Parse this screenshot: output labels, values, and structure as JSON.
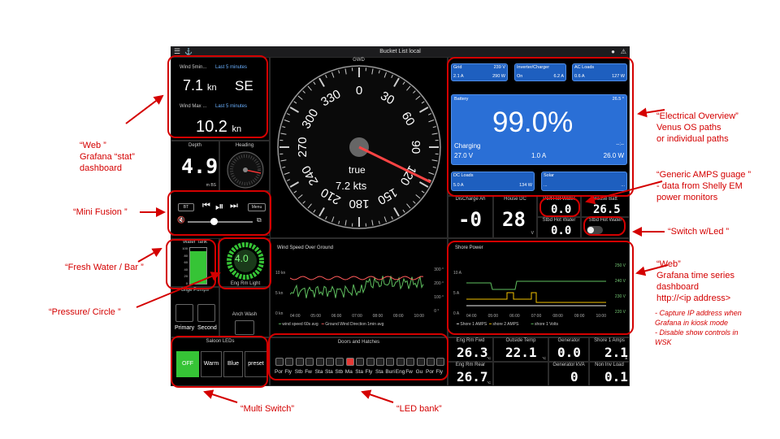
{
  "topbar": {
    "title": "Bucket List local"
  },
  "wind_speed": {
    "label": "Wind 5min...",
    "period": "Last 5 minutes",
    "value": "7.1",
    "unit": "kn",
    "direction": "SE"
  },
  "wind_max": {
    "label": "Wind Max ...",
    "period": "Last 5 minutes",
    "value": "10.2",
    "unit": "kn"
  },
  "depth": {
    "label": "Depth",
    "value": "4.9",
    "unit": "m BS"
  },
  "heading": {
    "label": "Heading"
  },
  "gwd": {
    "label": "GWD",
    "mode": "true",
    "speed": "7.2 kts",
    "ticks": [
      "0",
      "30",
      "60",
      "90",
      "120",
      "150",
      "180",
      "210",
      "240",
      "270",
      "300",
      "330"
    ]
  },
  "fusion": {
    "source": "BT",
    "menu": "Menu"
  },
  "water_tank": {
    "label": "Water Tank",
    "level_percent": 92,
    "ticks": [
      "100",
      "80",
      "60",
      "40",
      "20",
      "0"
    ]
  },
  "pressure": {
    "value": "4.0",
    "label": "Eng Rm Light"
  },
  "pumps": {
    "label": "Bilge Pumps",
    "primary": "Primary",
    "secondary": "Second",
    "anchor": "Anch Wash"
  },
  "saloon": {
    "label": "Saloon LEDs",
    "options": [
      "OFF",
      "Warm",
      "Blue",
      "preset"
    ],
    "active": "OFF"
  },
  "wind_chart": {
    "title": "Wind Speed Over Ground",
    "y_left": [
      "10 kn",
      "5 kn",
      "0 kn"
    ],
    "y_right": [
      "300 °",
      "200 °",
      "100 °",
      "0 °"
    ],
    "x_ticks": [
      "04:00",
      "05:00",
      "06:00",
      "07:00",
      "08:00",
      "09:00",
      "10:00"
    ],
    "legend": [
      "wind speed 60s avg",
      "Ground Wind Direction 1min avg"
    ]
  },
  "doors": {
    "label": "Doors and Hatches",
    "leds": [
      "Por",
      "Fly",
      "Stb",
      "Fw",
      "Sta",
      "Sta",
      "Stb",
      "Ma",
      "Sta",
      "Fly",
      "Sta",
      "Buri",
      "Eng",
      "Fw",
      "Gu",
      "Por",
      "Fly"
    ],
    "active_index": 7
  },
  "electrical": {
    "grid": {
      "label": "Grid",
      "voltage": "239 V",
      "current": "2.1 A",
      "power": "290 W"
    },
    "inverter": {
      "label": "Inverter/Charger",
      "state": "On",
      "current": "6.2 A"
    },
    "ac_loads": {
      "label": "AC Loads",
      "current": "0.6 A",
      "power": "127 W"
    },
    "battery": {
      "label": "Battery",
      "temp": "26.5 °",
      "soc": "99.0%",
      "state": "Charging",
      "voltage": "27.0 V",
      "current": "1.0 A",
      "power": "26.0 W",
      "time": "--:--"
    },
    "dc_loads": {
      "label": "DC Loads",
      "value": "5.0 A",
      "power": "134 W"
    },
    "solar": {
      "label": "Solar",
      "value": "...",
      "power": "..."
    }
  },
  "discharge": {
    "label": "DisCharge Ah",
    "value": "-0"
  },
  "house_dc": {
    "label": "House DC",
    "value": "28",
    "unit": "V"
  },
  "port_hot": {
    "label": "Port Hot Water",
    "value": "0.0"
  },
  "house_batt": {
    "label": "House Batt",
    "value": "26.5"
  },
  "stbd_hot": {
    "label": "Stbd Hot Water",
    "value": "0.0"
  },
  "stbd_switch": {
    "label": "Stbd Hot Water"
  },
  "shore_chart": {
    "title": "Shore Power",
    "y_right": [
      "250 V",
      "240 V",
      "230 V",
      "220 V"
    ],
    "y_left": [
      "10 A",
      "5 A",
      "0 A"
    ],
    "x_ticks": [
      "04:00",
      "05:00",
      "06:00",
      "07:00",
      "08:00",
      "09:00",
      "10:00"
    ],
    "legend": [
      "Shore 1 AMPS",
      "shore 2 AMPS",
      "shore 1 Volts"
    ]
  },
  "eng_fwd": {
    "label": "Eng Rm Fwd",
    "value": "26.3",
    "unit": "°C"
  },
  "outside": {
    "label": "Outside Temp",
    "value": "22.1",
    "unit": "°C"
  },
  "generator": {
    "label": "Generator",
    "value": "0.0"
  },
  "shore1amps": {
    "label": "Shore 1 Amps",
    "value": "2.1",
    "unit": "A"
  },
  "eng_rear": {
    "label": "Eng Rm Rear",
    "value": "26.7",
    "unit": "°C"
  },
  "gen_kva": {
    "label": "Generator kVA",
    "value": "0"
  },
  "non_inv": {
    "label": "Non Inv Load",
    "value": "0.1"
  },
  "callouts": {
    "web": [
      "“Web ”",
      "Grafana “stat”",
      "dashboard"
    ],
    "mini_fusion": "“Mini Fusion ”",
    "fresh_water": "“Fresh Water / Bar ”",
    "pressure": "“Pressure/ Circle ”",
    "multi_switch": "“Multi Switch”",
    "led_bank": "“LED bank”",
    "electrical": [
      "“Electrical Overview”",
      "Venus OS paths",
      "or individual  paths"
    ],
    "amps": [
      "“Generic AMPS guage ”",
      "- data from Shelly EM",
      "power monitors"
    ],
    "switch_led": "“Switch w/Led ”",
    "web2": [
      "“Web”",
      "Grafana time series",
      "dashboard",
      "http://<ip address>"
    ],
    "web2_notes": [
      "- Capture IP address when",
      "Grafana in kiosk mode",
      "- Disable show controls in",
      "WSK"
    ]
  }
}
